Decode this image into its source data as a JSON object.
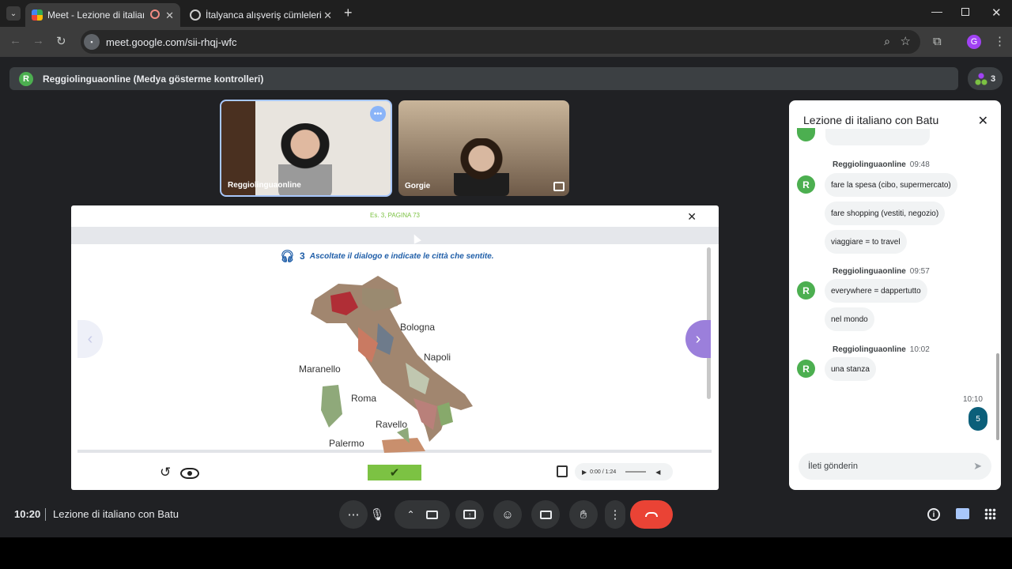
{
  "browser": {
    "tabs": [
      {
        "label": "Meet - Lezione di italiano c"
      },
      {
        "label": "İtalyanca alışveriş cümleleri"
      }
    ],
    "url": "meet.google.com/sii-rhqj-wfc",
    "profile_initial": "G",
    "participant_count": "3"
  },
  "presenter": {
    "label": "Reggiolinguaonline (Medya gösterme kontrolleri)",
    "initial": "R"
  },
  "tiles": [
    {
      "name": "Reggiolinguaonline"
    },
    {
      "name": "Gorgie"
    }
  ],
  "presentation": {
    "header": "Es. 3, PAGINA 73",
    "exercise_number": "3",
    "instruction": "Ascoltate il dialogo e indicate le città che sentite.",
    "cities": [
      "Bologna",
      "Napoli",
      "Maranello",
      "Roma",
      "Ravello",
      "Palermo"
    ],
    "audio_time": "0:00 / 1:24"
  },
  "chat": {
    "title": "Lezione di italiano con Batu",
    "groups": [
      {
        "sender": "Reggiolinguaonline",
        "time": "09:48",
        "messages": [
          "fare la spesa (cibo, supermercato)",
          "fare shopping (vestiti, negozio)",
          "viaggiare = to travel"
        ]
      },
      {
        "sender": "Reggiolinguaonline",
        "time": "09:57",
        "messages": [
          "everywhere = dappertutto",
          "nel mondo"
        ]
      },
      {
        "sender": "Reggiolinguaonline",
        "time": "10:02",
        "messages": [
          "una stanza"
        ]
      }
    ],
    "own_time": "10:10",
    "own_message": "5",
    "avatar_initial": "R",
    "input_placeholder": "İleti gönderin"
  },
  "footer": {
    "time": "10:20",
    "meeting_title": "Lezione di italiano con Batu"
  },
  "colors": {
    "end_call": "#ea4335",
    "accent_green": "#7cc243",
    "avatar_green": "#4caf50",
    "own_bubble": "#0b5f7a"
  }
}
